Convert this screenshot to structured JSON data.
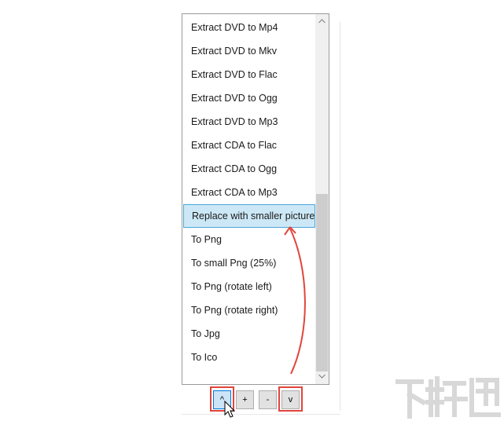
{
  "list": {
    "items": [
      {
        "label": "Extract DVD to Mp4"
      },
      {
        "label": "Extract DVD to Mkv"
      },
      {
        "label": "Extract DVD to Flac"
      },
      {
        "label": "Extract DVD to Ogg"
      },
      {
        "label": "Extract DVD to Mp3"
      },
      {
        "label": "Extract CDA to Flac"
      },
      {
        "label": "Extract CDA to Ogg"
      },
      {
        "label": "Extract CDA to Mp3"
      },
      {
        "label": "Replace with smaller picture",
        "selected": true
      },
      {
        "label": "To Png"
      },
      {
        "label": "To small Png (25%)"
      },
      {
        "label": "To Png (rotate left)"
      },
      {
        "label": "To Png (rotate right)"
      },
      {
        "label": "To Jpg"
      },
      {
        "label": "To Ico"
      }
    ]
  },
  "buttons": {
    "move_up_label": "^",
    "add_label": "+",
    "remove_label": "-",
    "move_down_label": "v"
  },
  "colors": {
    "selection_bg": "#cce8f6",
    "selection_border": "#50a6d8",
    "annotation": "#e1453b"
  }
}
